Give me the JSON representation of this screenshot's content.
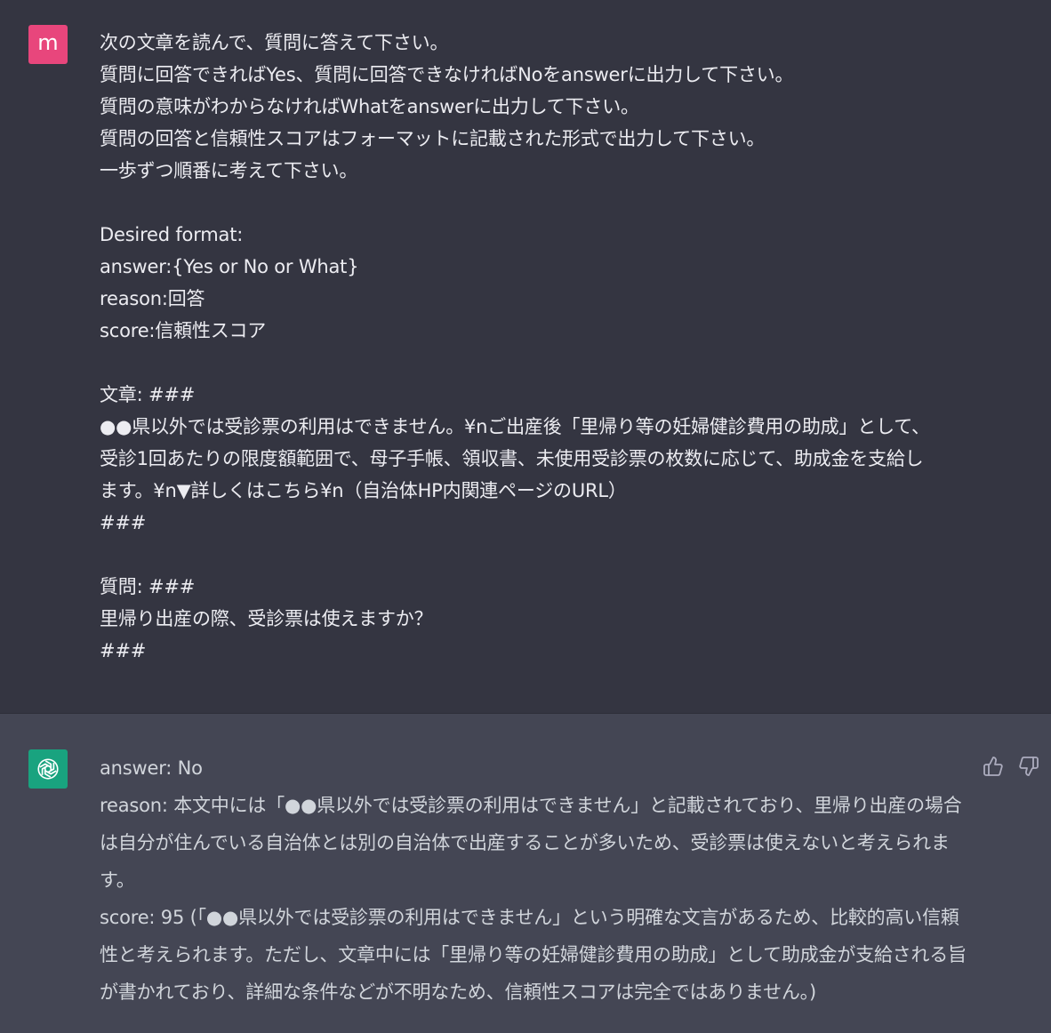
{
  "user_message": {
    "avatar_letter": "m",
    "lines": [
      "次の文章を読んで、質問に答えて下さい。",
      "質問に回答できればYes、質問に回答できなければNoをanswerに出力して下さい。",
      "質問の意味がわからなければWhatをanswerに出力して下さい。",
      "質問の回答と信頼性スコアはフォーマットに記載された形式で出力して下さい。",
      "一歩ずつ順番に考えて下さい。",
      "",
      "Desired format:",
      "answer:{Yes or No or What}",
      "reason:回答",
      "score:信頼性スコア",
      "",
      "文章: ###",
      "●●県以外では受診票の利用はできません。¥nご出産後「里帰り等の妊婦健診費用の助成」として、",
      "受診1回あたりの限度額範囲で、母子手帳、領収書、未使用受診票の枚数に応じて、助成金を支給し",
      "ます。¥n▼詳しくはこちら¥n（自治体HP内関連ページのURL）",
      "###",
      "",
      "質問: ###",
      "里帰り出産の際、受診票は使えますか？",
      "###"
    ]
  },
  "assistant_message": {
    "avatar_icon": "openai-logo-icon",
    "answer": "answer: No",
    "reason": "reason: 本文中には「●●県以外では受診票の利用はできません」と記載されており、里帰り出産の場合は自分が住んでいる自治体とは別の自治体で出産することが多いため、受診票は使えないと考えられます。",
    "score": "score: 95 (「●●県以外では受診票の利用はできません」という明確な文言があるため、比較的高い信頼性と考えられます。ただし、文章中には「里帰り等の妊婦健診費用の助成」として助成金が支給される旨が書かれており、詳細な条件などが不明なため、信頼性スコアは完全ではありません。)",
    "feedback": {
      "thumbs_up_icon": "thumbs-up-icon",
      "thumbs_down_icon": "thumbs-down-icon"
    }
  },
  "colors": {
    "page_background": "#343541",
    "assistant_background": "#444654",
    "user_avatar": "#e8467c",
    "assistant_avatar": "#19a37f",
    "user_text": "#ececf1",
    "assistant_text": "#d1d5db"
  }
}
